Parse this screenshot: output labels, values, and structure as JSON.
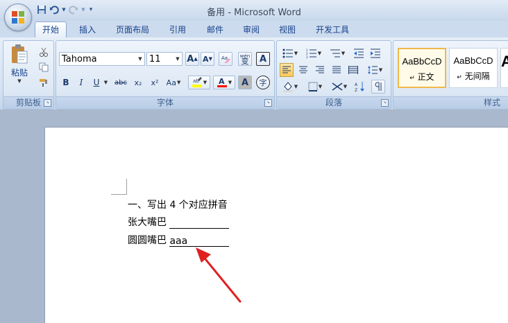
{
  "window": {
    "title": "备用 - Microsoft Word"
  },
  "quick_access": {
    "icons": [
      "save-icon",
      "undo-icon",
      "redo-icon",
      "customize-icon"
    ]
  },
  "tabs": [
    {
      "label": "开始",
      "active": true
    },
    {
      "label": "插入"
    },
    {
      "label": "页面布局"
    },
    {
      "label": "引用"
    },
    {
      "label": "邮件"
    },
    {
      "label": "审阅"
    },
    {
      "label": "视图"
    },
    {
      "label": "开发工具"
    }
  ],
  "ribbon": {
    "clipboard": {
      "label": "剪贴板",
      "paste_label": "粘贴"
    },
    "font": {
      "label": "字体",
      "font_name": "Tahoma",
      "font_size": "11",
      "bold": "B",
      "italic": "I",
      "underline": "U",
      "strike": "abc",
      "subscript": "x₂",
      "superscript": "x²",
      "change_case": "Aa",
      "grow": "A",
      "shrink": "A",
      "phonetic": "wén",
      "phonetic_char": "变",
      "char_border": "A",
      "shade": "A",
      "enclose": "字",
      "highlight_color": "#ffff00",
      "font_color": "#ff0000"
    },
    "paragraph": {
      "label": "段落"
    },
    "styles": {
      "label": "样式",
      "items": [
        {
          "sample": "AaBbCcD",
          "name": "正文",
          "selected": true
        },
        {
          "sample": "AaBbCcD",
          "name": "无间隔"
        },
        {
          "sample": "A",
          "name": ""
        }
      ]
    }
  },
  "document": {
    "lines": [
      {
        "text": "一、写出 4 个对应拼音"
      },
      {
        "text": "张大嘴巴",
        "answer": ""
      },
      {
        "text": "圆圆嘴巴",
        "answer": "aaa"
      }
    ]
  },
  "annotation": {
    "arrow_color": "#e02020"
  }
}
